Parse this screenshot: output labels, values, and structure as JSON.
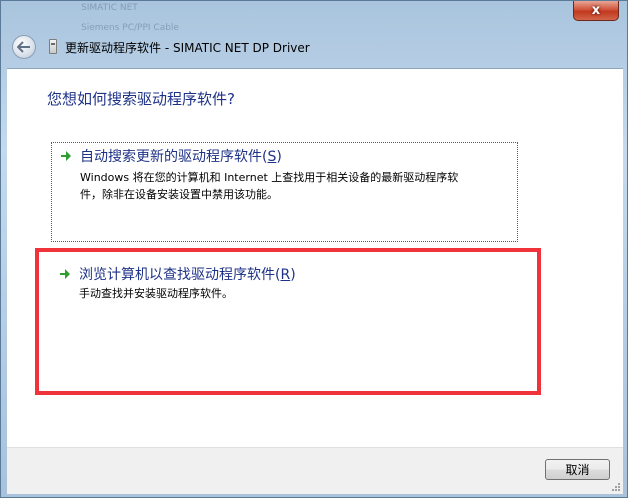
{
  "window": {
    "title": "更新驱动程序软件 - SIMATIC NET DP Driver",
    "close_label": "x",
    "background_glimpse": [
      "SIMATIC NET",
      "Siemens PC/PPI Cable"
    ]
  },
  "dialog": {
    "question": "您想如何搜索驱动程序软件?",
    "options": [
      {
        "title": "自动搜索更新的驱动程序软件(",
        "accel": "S",
        "title_end": ")",
        "desc_line1": "Windows 将在您的计算机和 Internet 上查找用于相关设备的最新驱动程序软",
        "desc_line2": "件，除非在设备安装设置中禁用该功能。"
      },
      {
        "title": "浏览计算机以查找驱动程序软件(",
        "accel": "R",
        "title_end": ")",
        "desc_line1": "手动查找并安装驱动程序软件。"
      }
    ]
  },
  "footer": {
    "cancel_label": "取消"
  },
  "colors": {
    "heading": "#1e3287",
    "highlight": "#f0333b",
    "arrow": "#2e9e2e"
  },
  "icons": {
    "back": "back-arrow-icon",
    "title": "device-icon",
    "option_arrow": "green-arrow-icon"
  }
}
